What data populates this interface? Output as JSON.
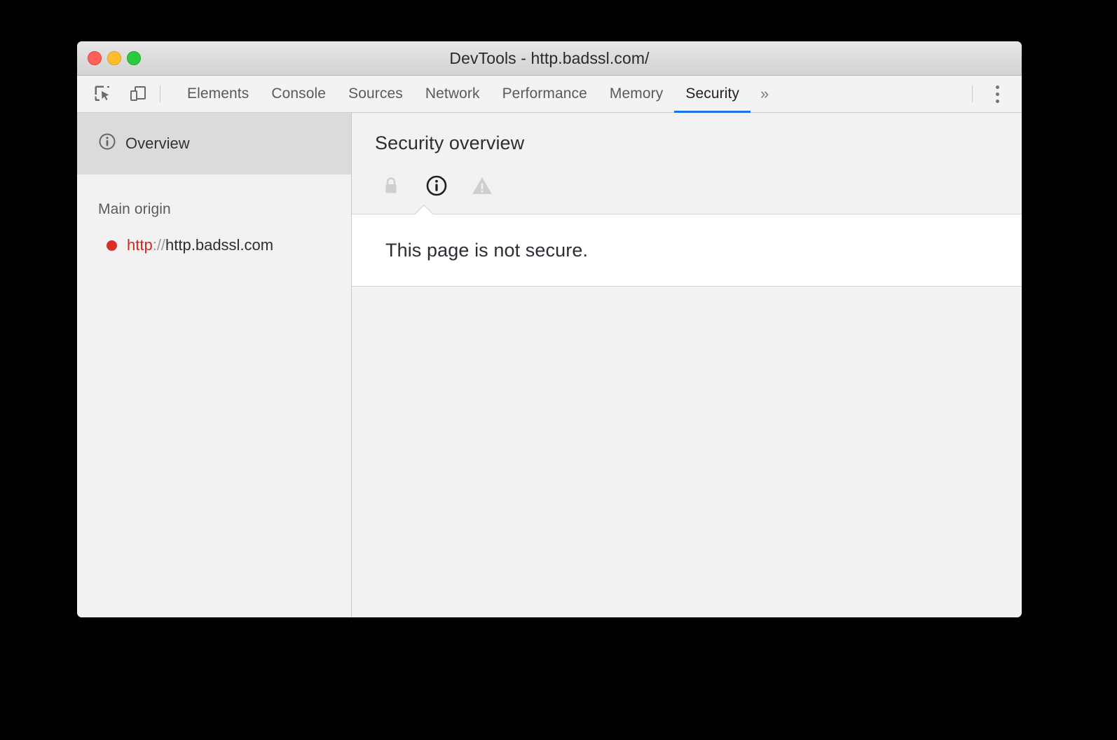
{
  "window": {
    "title": "DevTools - http.badssl.com/",
    "traffic_lights": [
      {
        "name": "close",
        "color": "#ff6158"
      },
      {
        "name": "minimize",
        "color": "#ffbd2e"
      },
      {
        "name": "maximize",
        "color": "#2acb42"
      }
    ]
  },
  "toolbar": {
    "inspect_icon": "inspect-element-icon",
    "device_icon": "device-toolbar-icon",
    "more_tabs_label": "»",
    "menu_icon": "vertical-dots-menu-icon"
  },
  "tabs": [
    {
      "label": "Elements",
      "active": false
    },
    {
      "label": "Console",
      "active": false
    },
    {
      "label": "Sources",
      "active": false
    },
    {
      "label": "Network",
      "active": false
    },
    {
      "label": "Performance",
      "active": false
    },
    {
      "label": "Memory",
      "active": false
    },
    {
      "label": "Security",
      "active": true
    }
  ],
  "sidebar": {
    "overview": {
      "label": "Overview",
      "icon": "info-circle-icon",
      "selected": true
    },
    "group_title": "Main origin",
    "origins": [
      {
        "status_color": "#d93025",
        "scheme": "http",
        "separator": "://",
        "host": "http.badssl.com"
      }
    ]
  },
  "main": {
    "title": "Security overview",
    "state_icons": [
      {
        "name": "lock-icon",
        "state": "inactive"
      },
      {
        "name": "info-circle-icon",
        "state": "active"
      },
      {
        "name": "warning-triangle-icon",
        "state": "inactive"
      }
    ],
    "explanation": "This page is not secure."
  },
  "colors": {
    "accent": "#1a73e8",
    "insecure": "#d93025",
    "window_bg": "#f2f2f2",
    "panel_bg": "#ffffff",
    "selected_row": "#dbdbdb"
  }
}
